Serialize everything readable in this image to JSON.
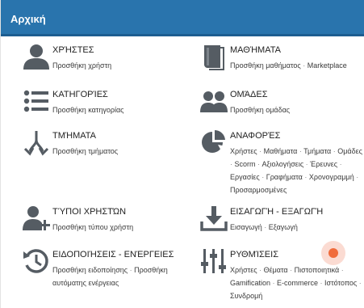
{
  "header": {
    "title": "Αρχική"
  },
  "tiles": {
    "users": {
      "title": "ΧΡΉΣΤΕΣ",
      "icon": "user-icon",
      "links": [
        "Προσθήκη χρήστη"
      ]
    },
    "courses": {
      "title": "ΜΑΘΉΜΑΤΑ",
      "icon": "book-icon",
      "links": [
        "Προσθήκη μαθήματος",
        "Marketplace"
      ]
    },
    "categories": {
      "title": "ΚΑΤΗΓΟΡΊΕΣ",
      "icon": "list-icon",
      "links": [
        "Προσθήκη κατηγορίας"
      ]
    },
    "groups": {
      "title": "ΟΜΆΔΕΣ",
      "icon": "group-icon",
      "links": [
        "Προσθήκη ομάδας"
      ]
    },
    "branches": {
      "title": "ΤΜΉΜΑΤΑ",
      "icon": "branch-icon",
      "links": [
        "Προσθήκη τμήματος"
      ]
    },
    "reports": {
      "title": "ΑΝΑΦΟΡΈΣ",
      "icon": "pie-chart-icon",
      "links": [
        "Χρήστες",
        "Μαθήματα",
        "Τμήματα",
        "Ομάδες",
        "Scorm",
        "Αξιολογήσεις",
        "Έρευνες",
        "Εργασίες",
        "Γραφήματα",
        "Χρονογραμμή",
        "Προσαρμοσμένες"
      ]
    },
    "user_types": {
      "title": "ΤΎΠΟΙ ΧΡΗΣΤΏΝ",
      "icon": "user-plus-icon",
      "links": [
        "Προσθήκη τύπου χρήστη"
      ]
    },
    "import_export": {
      "title": "ΕΙΣΑΓΩΓΉ - ΕΞΑΓΩΓΉ",
      "icon": "download-tray-icon",
      "links": [
        "Εισαγωγή",
        "Εξαγωγή"
      ]
    },
    "notifications": {
      "title": "ΕΙΔΟΠΟΙΉΣΕΙΣ - ΕΝΈΡΓΕΙΕΣ",
      "icon": "history-icon",
      "links": [
        "Προσθήκη ειδοποίησης",
        "Προσθήκη αυτόματης ενέργειας"
      ]
    },
    "settings": {
      "title": "ΡΥΘΜΊΣΕΙΣ",
      "icon": "sliders-icon",
      "links": [
        "Χρήστες",
        "Θέματα",
        "Πιστοποιητικά",
        "Gamification",
        "E-commerce",
        "Ιστότοπος",
        "Συνδρομή"
      ]
    }
  },
  "colors": {
    "header": "#2974ad",
    "icon": "#555c63",
    "notification_dot": "#f06c3c"
  }
}
